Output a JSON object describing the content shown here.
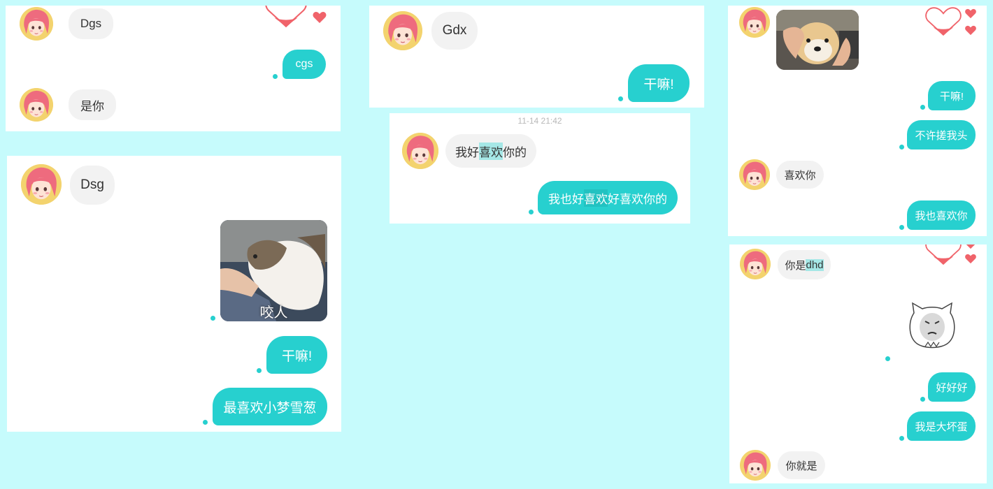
{
  "panel1": {
    "msgs": [
      "Dgs",
      "cgs",
      "是你"
    ]
  },
  "panel2": {
    "msgs": [
      "Dsg",
      "咬人",
      "干嘛!",
      "最喜欢小梦雪葱"
    ]
  },
  "panel3": {
    "msgs": [
      "Gdx",
      "干嘛!"
    ]
  },
  "panel4": {
    "timestamp": "11-14 21:42",
    "msg1": {
      "pre": "我好",
      "hl": "喜欢",
      "post": "你的"
    },
    "msg2": {
      "pre": "我也好",
      "hl": "喜欢",
      "post": "好喜欢你的"
    }
  },
  "panel5": {
    "msgs": [
      "干嘛!",
      "不许搓我头",
      "喜欢你",
      "我也喜欢你"
    ]
  },
  "panel6": {
    "msg1": {
      "pre": "你是",
      "hl": "dhd"
    },
    "msgs": [
      "好好好",
      "我是大坏蛋",
      "你就是"
    ]
  },
  "colors": {
    "background": "#c6fbfc",
    "outgoing_bubble": "#27d0cf",
    "incoming_bubble": "#f2f2f2",
    "heart": "#f0636a"
  }
}
